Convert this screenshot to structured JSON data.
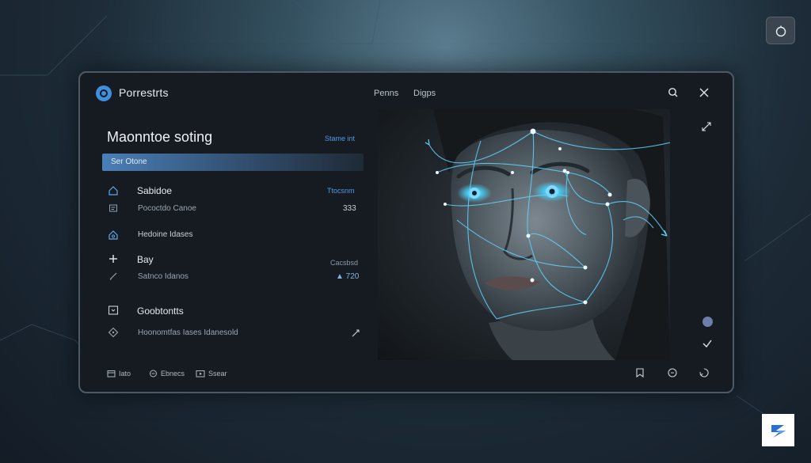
{
  "app": {
    "title": "Porrestrts",
    "nav": [
      "Penns",
      "Digps"
    ]
  },
  "main": {
    "section_title": "Maonntoe soting",
    "section_link": "Stame int",
    "search_placeholder": "Ser Otone"
  },
  "groups": [
    {
      "label": "Sabidoe",
      "right_link": "Ttocsnm",
      "sub_label": "Pococtdo Canoe",
      "sub_value": "333"
    },
    {
      "label": "Hedoine Idases"
    },
    {
      "label": "Bay",
      "right_note": "Cacsbsd",
      "sub_label": "Satnco Idanos",
      "sub_value": "▲ 720"
    },
    {
      "label": "Goobtontts",
      "sub_label": "Hoonomtfas Iases Idanesold"
    }
  ],
  "bottom_tabs": [
    "Iato",
    "Ebnecs",
    "Ssear"
  ],
  "icons": {
    "corner": "circle-toggle-icon",
    "logo": "logo-icon",
    "search": "search-icon",
    "close": "close-icon",
    "expand": "expand-icon",
    "confirm": "check-icon",
    "brand": "brand-logo"
  },
  "colors": {
    "accent": "#4d9be8",
    "window_bg": "#161b22",
    "mesh": "#5fd4ff"
  }
}
